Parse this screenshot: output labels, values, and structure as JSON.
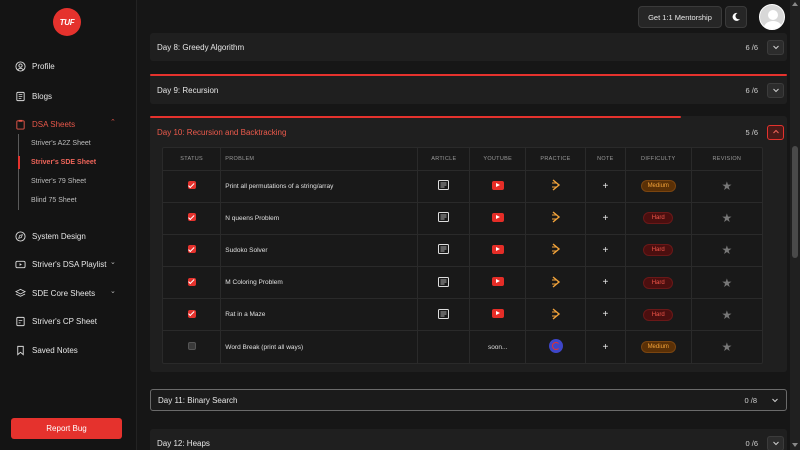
{
  "logo": {
    "text": "TUF",
    "color": "#e5322d"
  },
  "sidebar": {
    "items": [
      {
        "label": "Profile",
        "icon": "user-icon"
      },
      {
        "label": "Blogs",
        "icon": "document-icon"
      },
      {
        "label": "DSA Sheets",
        "icon": "clipboard-icon",
        "expanded": true
      },
      {
        "label": "System Design",
        "icon": "compass-icon"
      },
      {
        "label": "Striver's DSA Playlist",
        "icon": "video-icon"
      },
      {
        "label": "SDE Core Sheets",
        "icon": "layers-icon"
      },
      {
        "label": "Striver's CP Sheet",
        "icon": "sheet-icon"
      },
      {
        "label": "Saved Notes",
        "icon": "bookmark-icon"
      }
    ],
    "sub_items": [
      {
        "label": "Striver's A2Z Sheet"
      },
      {
        "label": "Striver's SDE Sheet",
        "selected": true
      },
      {
        "label": "Striver's 79 Sheet"
      },
      {
        "label": "Blind 75 Sheet"
      }
    ],
    "report_bug": "Report Bug"
  },
  "topbar": {
    "mentorship": "Get 1:1 Mentorship",
    "theme_icon": "moon-icon"
  },
  "days": [
    {
      "title": "Day 8: Greedy Algorithm",
      "count": "6 /6",
      "progress": 1.0
    },
    {
      "title": "Day 9: Recursion",
      "count": "6 /6",
      "progress": 1.0
    },
    {
      "title": "Day 10: Recursion and Backtracking",
      "count": "5 /6",
      "progress": 0.833
    },
    {
      "title": "Day 11: Binary Search",
      "count": "0 /8",
      "progress": 0
    },
    {
      "title": "Day 12: Heaps",
      "count": "0 /6",
      "progress": 0
    }
  ],
  "table": {
    "headers": {
      "status": "STATUS",
      "problem": "PROBLEM",
      "article": "ARTICLE",
      "youtube": "YOUTUBE",
      "practice": "PRACTICE",
      "note": "NOTE",
      "difficulty": "DIFFICULTY",
      "revision": "REVISION"
    },
    "rows": [
      {
        "problem": "Print all permutations of a string/array",
        "difficulty": "Medium",
        "checked": true
      },
      {
        "problem": "N queens Problem",
        "difficulty": "Hard",
        "checked": true
      },
      {
        "problem": "Sudoko Solver",
        "difficulty": "Hard",
        "checked": true
      },
      {
        "problem": "M Coloring Problem",
        "difficulty": "Hard",
        "checked": true
      },
      {
        "problem": "Rat in a Maze",
        "difficulty": "Hard",
        "checked": true
      },
      {
        "problem": "Word Break (print all ways)",
        "difficulty": "Medium",
        "checked": false,
        "youtube_text": "soon..."
      }
    ],
    "note_symbol": "+",
    "revision_symbol": "★"
  },
  "colors": {
    "accent": "#e5322d",
    "medium": "#f2a33a",
    "hard": "#f0564a"
  }
}
